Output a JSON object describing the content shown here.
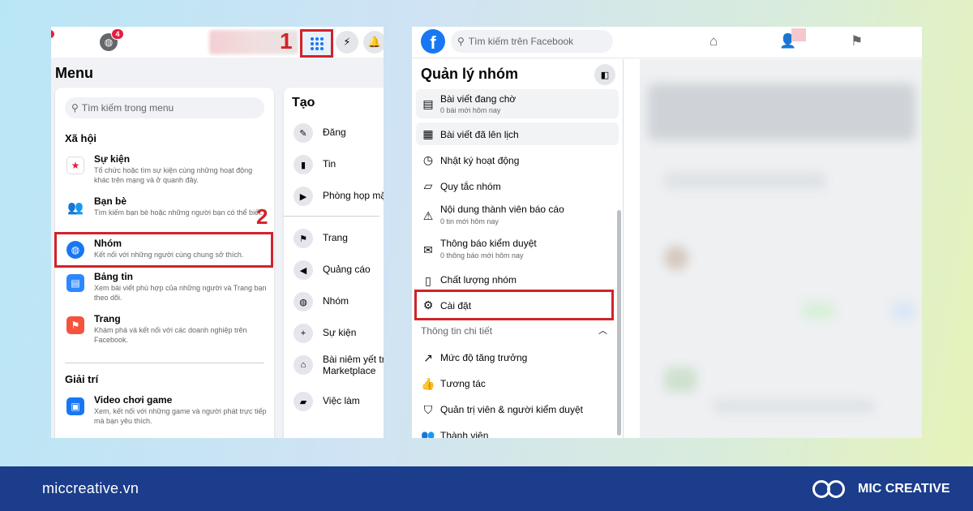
{
  "left": {
    "notification_count": "4",
    "step1": "1",
    "step2": "2",
    "menu_title": "Menu",
    "search_placeholder": "Tìm kiếm trong menu",
    "social_section": "Xã hội",
    "entertainment_section": "Giải trí",
    "items": [
      {
        "title": "Sự kiện",
        "desc": "Tổ chức hoặc tìm sự kiện cùng những hoạt động khác trên mạng và ở quanh đây.",
        "icon": "calendar-icon",
        "color": "#e41e3f"
      },
      {
        "title": "Bạn bè",
        "desc": "Tìm kiếm bạn bè hoặc những người bạn có thể biết.",
        "icon": "friends-icon",
        "color": "#1877f2"
      },
      {
        "title": "Nhóm",
        "desc": "Kết nối với những người cùng chung sở thích.",
        "icon": "groups-icon",
        "color": "#1877f2"
      },
      {
        "title": "Bảng tin",
        "desc": "Xem bài viết phù hợp của những người và Trang bạn theo dõi.",
        "icon": "feed-icon",
        "color": "#1877f2"
      },
      {
        "title": "Trang",
        "desc": "Khám phá và kết nối với các doanh nghiệp trên Facebook.",
        "icon": "flag-icon",
        "color": "#f5533d"
      }
    ],
    "game_item": {
      "title": "Video chơi game",
      "desc": "Xem, kết nối với những game và người phát trực tiếp mà bạn yêu thích.",
      "icon": "gaming-icon",
      "color": "#1877f2"
    },
    "create_title": "Tạo",
    "create_items": [
      {
        "label": "Đăng",
        "icon": "edit-icon"
      },
      {
        "label": "Tin",
        "icon": "book-icon"
      },
      {
        "label": "Phòng họp mặ",
        "icon": "video-icon"
      },
      {
        "label": "Trang",
        "icon": "flag-icon"
      },
      {
        "label": "Quảng cáo",
        "icon": "megaphone-icon"
      },
      {
        "label": "Nhóm",
        "icon": "groups-icon"
      },
      {
        "label": "Sự kiện",
        "icon": "plus-icon"
      },
      {
        "label": "Bài niêm yết tr",
        "label2": "Marketplace",
        "icon": "shop-icon"
      },
      {
        "label": "Việc làm",
        "icon": "briefcase-icon"
      }
    ]
  },
  "right": {
    "search_placeholder": "Tìm kiếm trên Facebook",
    "title": "Quản lý nhóm",
    "items": [
      {
        "title": "Bài viết đang chờ",
        "sub": "0 bài mới hôm nay",
        "icon": "pending-icon"
      },
      {
        "title": "Bài viết đã lên lịch",
        "sub": "",
        "icon": "calendar-icon"
      },
      {
        "title": "Nhật ký hoạt động",
        "sub": "",
        "icon": "clock-icon"
      },
      {
        "title": "Quy tắc nhóm",
        "sub": "",
        "icon": "rules-icon"
      },
      {
        "title": "Nội dung thành viên báo cáo",
        "sub": "0 tin mới hôm nay",
        "icon": "report-icon"
      },
      {
        "title": "Thông báo kiểm duyệt",
        "sub": "0 thông báo mới hôm nay",
        "icon": "moderation-icon"
      },
      {
        "title": "Chất lượng nhóm",
        "sub": "",
        "icon": "clipboard-icon"
      },
      {
        "title": "Cài đặt",
        "sub": "",
        "icon": "gear-icon"
      }
    ],
    "info_title": "Thông tin chi tiết",
    "info_items": [
      {
        "title": "Mức độ tăng trưởng",
        "icon": "growth-icon"
      },
      {
        "title": "Tương tác",
        "icon": "like-icon"
      },
      {
        "title": "Quản trị viên & người kiểm duyệt",
        "icon": "shield-icon"
      },
      {
        "title": "Thành viên",
        "icon": "members-icon"
      }
    ]
  },
  "footer": {
    "site": "miccreative.vn",
    "brand": "MIC CREATIVE"
  },
  "colors": {
    "highlight": "#d1232a",
    "facebook_blue": "#1877f2",
    "footer_bg": "#1c3d8c"
  }
}
